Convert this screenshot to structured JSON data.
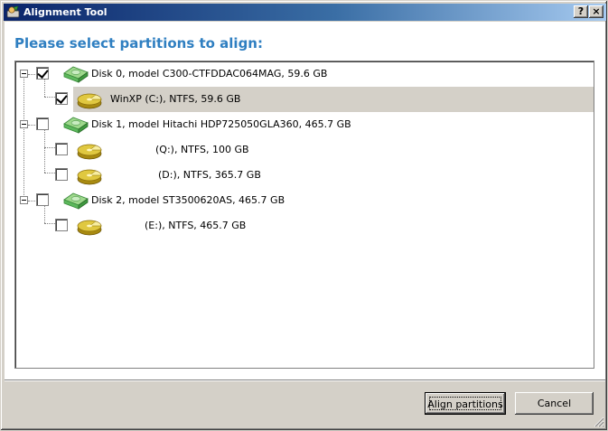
{
  "window": {
    "title": "Alignment Tool",
    "help_button": "?",
    "close_button": "×"
  },
  "heading": "Please select partitions to align:",
  "tree": {
    "disks": [
      {
        "label": "Disk 0, model C300-CTFDDAC064MAG, 59.6 GB",
        "checked": true,
        "partitions": [
          {
            "label": "WinXP (C:), NTFS, 59.6 GB",
            "checked": true,
            "selected": true
          }
        ]
      },
      {
        "label": "Disk 1, model Hitachi HDP725050GLA360, 465.7 GB",
        "checked": false,
        "partitions": [
          {
            "label": "(Q:), NTFS, 100 GB",
            "checked": false,
            "selected": false
          },
          {
            "label": "(D:), NTFS, 365.7 GB",
            "checked": false,
            "selected": false
          }
        ]
      },
      {
        "label": "Disk 2, model ST3500620AS, 465.7 GB",
        "checked": false,
        "partitions": [
          {
            "label": "(E:), NTFS, 465.7 GB",
            "checked": false,
            "selected": false
          }
        ]
      }
    ]
  },
  "buttons": {
    "align": "Align partitions",
    "cancel": "Cancel"
  },
  "icons": {
    "title": "alignment-tool-icon",
    "disk": "hard-disk-icon",
    "partition": "partition-icon"
  },
  "colors": {
    "heading": "#2f7fc1",
    "title_start": "#0a246a",
    "title_end": "#a6caf0",
    "disk_icon": "#5cb85c",
    "partition_icon": "#c8a820"
  }
}
